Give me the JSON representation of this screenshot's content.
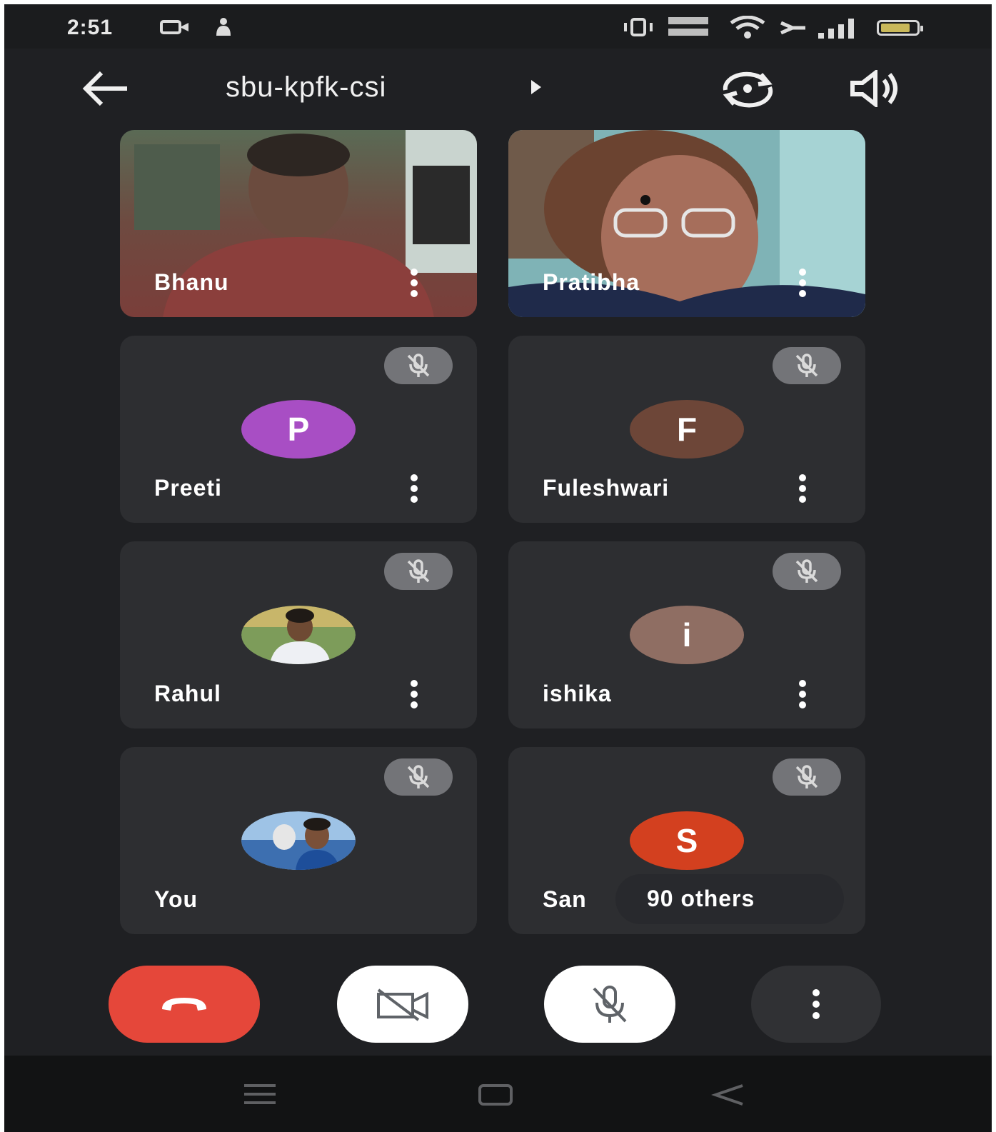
{
  "status_bar": {
    "time": "2:51",
    "icons": [
      "cast-icon",
      "notification-icon",
      "vibrate-icon",
      "data-speed-icon",
      "wifi-icon",
      "signal-icon",
      "battery-icon"
    ],
    "battery_level": 0.85,
    "battery_color": "#c9b85a"
  },
  "header": {
    "meeting_code": "sbu-kpfk-csi",
    "actions": [
      "back-arrow-icon",
      "switch-camera-icon",
      "speaker-icon"
    ]
  },
  "participants": [
    {
      "name": "Bhanu",
      "type": "video",
      "muted": false
    },
    {
      "name": "Pratibha",
      "type": "video",
      "muted": false
    },
    {
      "name": "Preeti",
      "type": "initial",
      "initial": "P",
      "avatar_color": "#a84ec4",
      "muted": true
    },
    {
      "name": "Fuleshwari",
      "type": "initial",
      "initial": "F",
      "avatar_color": "#6d4638",
      "muted": true
    },
    {
      "name": "Rahul",
      "type": "photo",
      "muted": true
    },
    {
      "name": "ishika",
      "type": "initial",
      "initial": "i",
      "avatar_color": "#8f6e63",
      "muted": true
    },
    {
      "name": "You",
      "type": "photo",
      "muted": true
    },
    {
      "name": "San",
      "type": "initial",
      "initial": "S",
      "avatar_color": "#d3401f",
      "muted": true
    }
  ],
  "others_label": "90 others",
  "controls": {
    "end_call_color": "#e5473a",
    "items": [
      "end-call-icon",
      "camera-off-icon",
      "mic-off-icon",
      "more-options-icon"
    ]
  },
  "nav_bar": [
    "recents-icon",
    "home-icon",
    "back-icon"
  ]
}
